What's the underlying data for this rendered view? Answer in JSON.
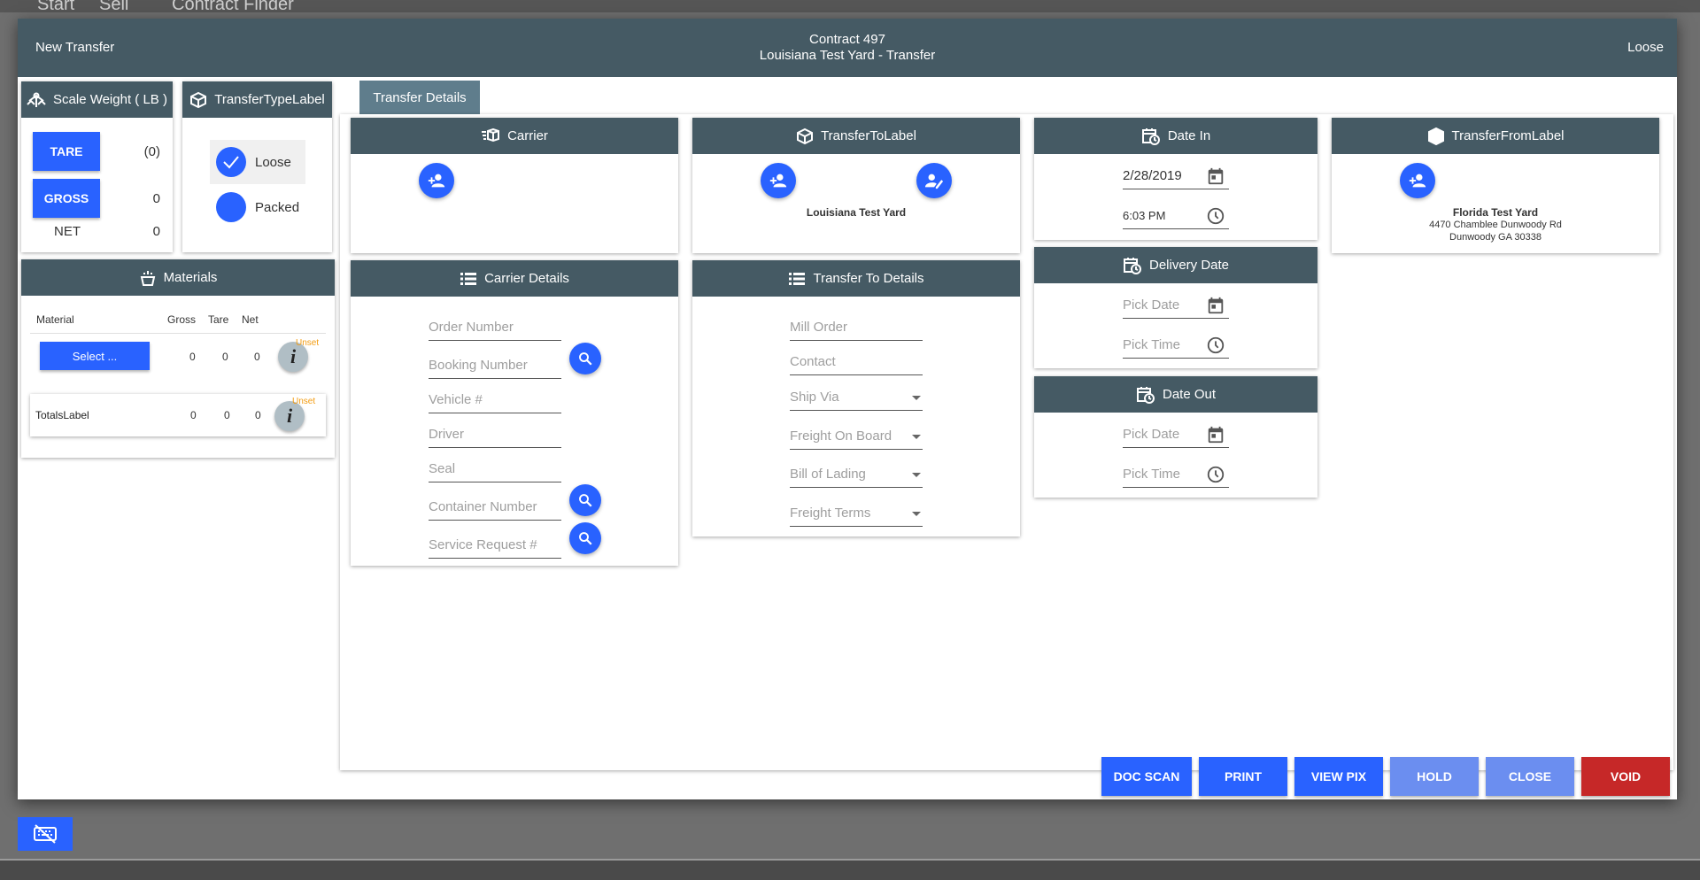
{
  "background": {
    "menu_items": [
      "Start",
      "Sell",
      "Contract Finder"
    ]
  },
  "header": {
    "left": "New Transfer",
    "title_line1": "Contract 497",
    "title_line2": "Louisiana Test Yard - Transfer",
    "right": "Loose"
  },
  "scale_weight": {
    "title": "Scale Weight ( LB )",
    "tare_label": "TARE",
    "tare_value": "(0)",
    "gross_label": "GROSS",
    "gross_value": "0",
    "net_label": "NET",
    "net_value": "0"
  },
  "transfer_type": {
    "title": "TransferTypeLabel",
    "options": [
      "Loose",
      "Packed"
    ],
    "selected": "Loose"
  },
  "materials": {
    "title": "Materials",
    "columns": [
      "Material",
      "Gross",
      "Tare",
      "Net"
    ],
    "row": {
      "button": "Select ...",
      "gross": "0",
      "tare": "0",
      "net": "0",
      "badge": "Unset"
    },
    "totals": {
      "label": "TotalsLabel",
      "gross": "0",
      "tare": "0",
      "net": "0",
      "badge": "Unset"
    },
    "info_glyph": "i"
  },
  "tabs": {
    "active": "Transfer Details"
  },
  "carrier": {
    "title": "Carrier"
  },
  "transfer_to": {
    "title": "TransferToLabel",
    "name": "Louisiana Test Yard"
  },
  "date_in": {
    "title": "Date In",
    "date": "2/28/2019",
    "time": "6:03 PM"
  },
  "delivery_date": {
    "title": "Delivery Date",
    "date_placeholder": "Pick Date",
    "time_placeholder": "Pick Time"
  },
  "date_out": {
    "title": "Date Out",
    "date_placeholder": "Pick Date",
    "time_placeholder": "Pick Time"
  },
  "transfer_from": {
    "title": "TransferFromLabel",
    "name": "Florida Test Yard",
    "address1": "4470 Chamblee Dunwoody Rd",
    "address2": "Dunwoody GA 30338"
  },
  "carrier_details": {
    "title": "Carrier Details",
    "fields": [
      "Order Number",
      "Booking Number",
      "Vehicle #",
      "Driver",
      "Seal",
      "Container Number",
      "Service Request #"
    ]
  },
  "transfer_to_details": {
    "title": "Transfer To Details",
    "fields": [
      "Mill Order",
      "Contact",
      "Ship Via",
      "Freight On Board",
      "Bill of Lading",
      "Freight Terms"
    ]
  },
  "footer": {
    "buttons": [
      "DOC SCAN",
      "PRINT",
      "VIEW PIX",
      "HOLD",
      "CLOSE",
      "VOID"
    ]
  },
  "colors": {
    "header": "#455a64",
    "primary": "#2962ff",
    "disabled": "#6b8ef0",
    "danger": "#c62828",
    "badge": "#f39c12"
  }
}
